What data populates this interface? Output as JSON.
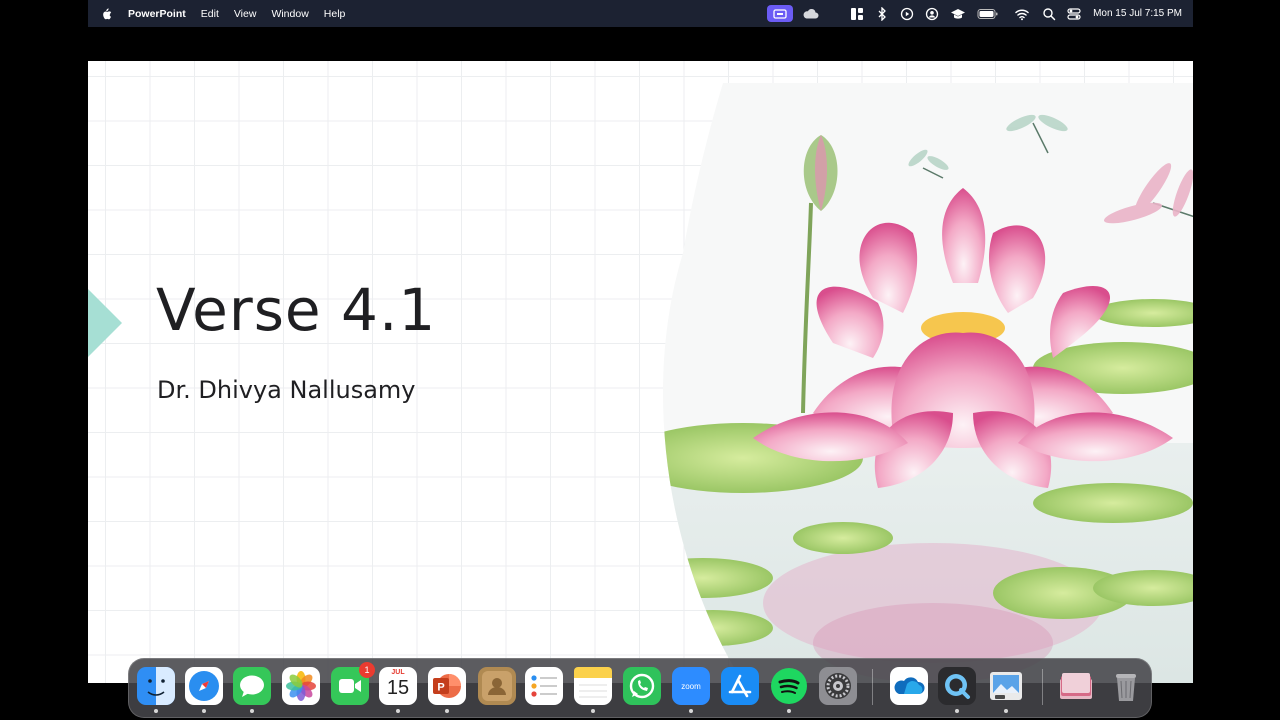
{
  "menubar": {
    "app_name": "PowerPoint",
    "menus": [
      "Edit",
      "View",
      "Window",
      "Help"
    ],
    "clock": "Mon 15 Jul  7:15 PM",
    "status_icons": [
      "screen-record-icon",
      "cloud-icon",
      "control-center-widgets-icon",
      "bluetooth-icon",
      "play-icon",
      "user-icon",
      "graduation-cap-icon",
      "battery-icon",
      "wifi-icon",
      "search-icon",
      "control-center-icon"
    ]
  },
  "slide": {
    "title": "Verse 4.1",
    "subtitle": "Dr. Dhivya Nallusamy",
    "accent_color": "#a6dfd4",
    "art": "watercolor pink lotus with lily pads and dragonflies"
  },
  "dock": {
    "apps": [
      {
        "name": "Finder",
        "icon": "finder-icon",
        "running": true
      },
      {
        "name": "Safari",
        "icon": "safari-icon",
        "running": true
      },
      {
        "name": "Messages",
        "icon": "messages-icon",
        "running": true
      },
      {
        "name": "Photos",
        "icon": "photos-icon",
        "running": false
      },
      {
        "name": "FaceTime",
        "icon": "facetime-icon",
        "running": false,
        "badge": "1"
      },
      {
        "name": "Calendar",
        "icon": "calendar-icon",
        "running": true,
        "month": "JUL",
        "day": "15"
      },
      {
        "name": "PowerPoint",
        "icon": "powerpoint-icon",
        "running": true
      },
      {
        "name": "Contacts",
        "icon": "contacts-icon",
        "running": false
      },
      {
        "name": "Reminders",
        "icon": "reminders-icon",
        "running": false
      },
      {
        "name": "Notes",
        "icon": "notes-icon",
        "running": true
      },
      {
        "name": "WhatsApp",
        "icon": "whatsapp-icon",
        "running": false
      },
      {
        "name": "Zoom",
        "icon": "zoom-icon",
        "running": true,
        "label": "zoom"
      },
      {
        "name": "App Store",
        "icon": "app-store-icon",
        "running": false
      },
      {
        "name": "Spotify",
        "icon": "spotify-icon",
        "running": true
      },
      {
        "name": "System Settings",
        "icon": "system-settings-icon",
        "running": false
      },
      {
        "name": "OneDrive",
        "icon": "onedrive-icon",
        "running": false
      },
      {
        "name": "QuickTime Player",
        "icon": "quicktime-icon",
        "running": true
      },
      {
        "name": "Preview",
        "icon": "preview-icon",
        "running": true
      },
      {
        "name": "Downloads",
        "icon": "downloads-stack-icon",
        "running": false
      },
      {
        "name": "Trash",
        "icon": "trash-icon",
        "running": false
      }
    ]
  }
}
